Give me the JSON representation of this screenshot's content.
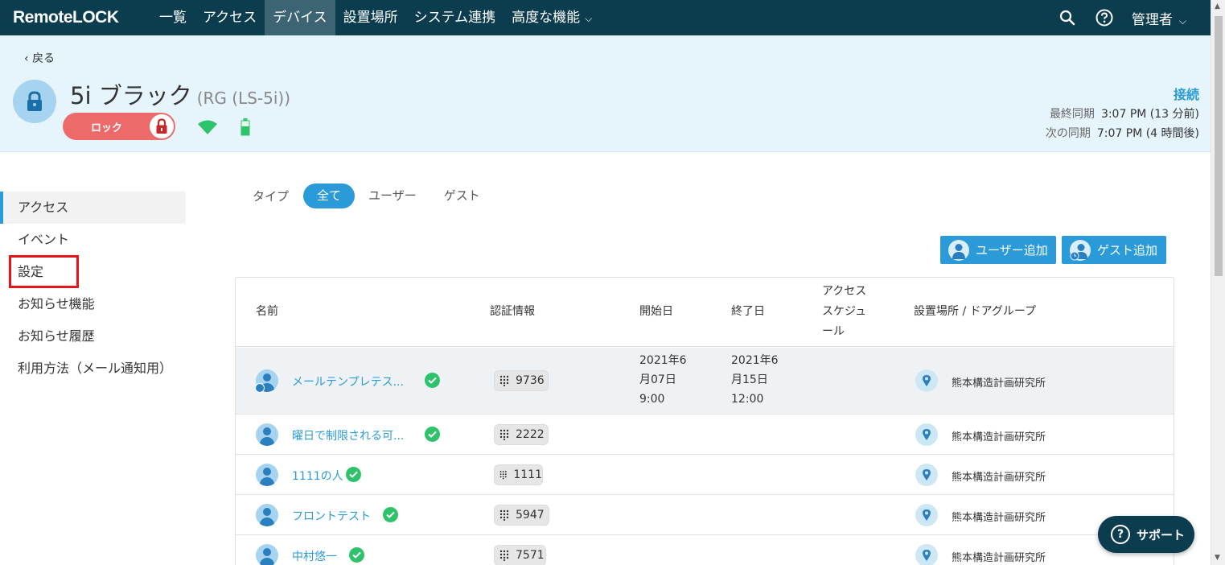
{
  "nav": {
    "logo": "RemoteLOCK",
    "items": [
      "一覧",
      "アクセス",
      "デバイス",
      "設置場所",
      "システム連携",
      "高度な機能"
    ],
    "user_label": "管理者"
  },
  "header": {
    "back_label": "戻る",
    "device_name": "5i ブラック",
    "device_model": "(RG (LS-5i))",
    "lock_label": "ロック",
    "connection_status": "接続",
    "last_sync_label": "最終同期",
    "last_sync_value": "3:07 PM (13 分前)",
    "next_sync_label": "次の同期",
    "next_sync_value": "7:07 PM (4 時間後)"
  },
  "sidebar": {
    "items": [
      "アクセス",
      "イベント",
      "設定",
      "お知らせ機能",
      "お知らせ履歴",
      "利用方法（メール通知用）"
    ]
  },
  "filter": {
    "label": "タイプ",
    "options": [
      "全て",
      "ユーザー",
      "ゲスト"
    ]
  },
  "buttons": {
    "add_user": "ユーザー追加",
    "add_guest": "ゲスト追加"
  },
  "table": {
    "headers": {
      "name": "名前",
      "credential": "認証情報",
      "start": "開始日",
      "end": "終了日",
      "schedule": "アクセス スケジュ ール",
      "location": "設置場所 / ドアグループ"
    },
    "rows": [
      {
        "name": "メールテンプレテス...",
        "pin": "9736",
        "start": "2021年6 月07日 9:00",
        "end": "2021年6 月15日 12:00",
        "location": "熊本構造計画研究所"
      },
      {
        "name": "曜日で制限される可...",
        "pin": "2222",
        "start": "",
        "end": "",
        "location": "熊本構造計画研究所"
      },
      {
        "name": "1111の人",
        "pin": "1111",
        "start": "",
        "end": "",
        "location": "熊本構造計画研究所"
      },
      {
        "name": "フロントテスト",
        "pin": "5947",
        "start": "",
        "end": "",
        "location": "熊本構造計画研究所"
      },
      {
        "name": "中村悠一",
        "pin": "7571",
        "start": "",
        "end": "",
        "location": "熊本構造計画研究所"
      }
    ]
  },
  "support": {
    "label": "サポート"
  },
  "colors": {
    "nav_bg": "#0c3d4f",
    "accent": "#2a9bd8",
    "lock_badge": "#ec6a6a",
    "ok_green": "#2ec36a",
    "header_bg": "#e6f4fb"
  }
}
